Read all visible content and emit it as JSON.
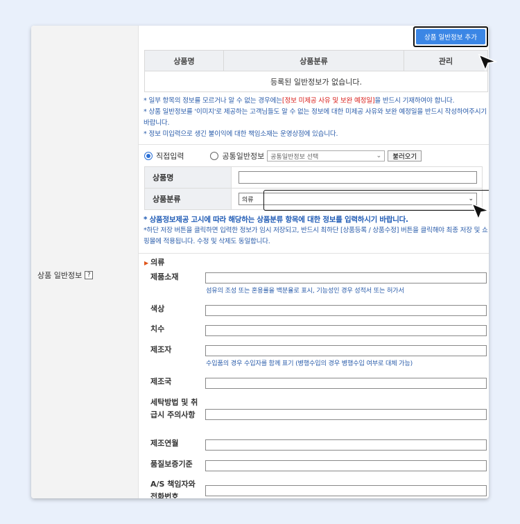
{
  "sidebar": {
    "label": "상품 일반정보",
    "help": "?"
  },
  "toolbar": {
    "add_button": "상품 일반정보 추가"
  },
  "list_table": {
    "headers": [
      "상품명",
      "상품분류",
      "관리"
    ],
    "empty_message": "등록된 일반정보가 없습니다."
  },
  "notes": {
    "line1_a": "* 일부 항목의 정보를 모르거나 알 수 없는 경우에는",
    "line1_red": "[정보 미제공 사유 및 보완 예정일]",
    "line1_b": "을 반드시 기재하여야 합니다.",
    "line2": "* 상품 일반정보를 '이미지'로 제공하는 고객님들도 알 수 없는 정보에 대한 미제공 사유와 보완 예정일을 반드시 작성하여주시기 바랍니다.",
    "line3": "* 정보 미입력으로 생긴 불이익에 대한 책임소재는 운영상점에 있습니다."
  },
  "input_mode": {
    "direct_label": "직접입력",
    "common_label": "공통일반정보",
    "common_select": "공통일반정보 선택",
    "load_button": "불러오기"
  },
  "form": {
    "name_label": "상품명",
    "category_label": "상품분류",
    "category_value": "의류"
  },
  "guide": {
    "bold": "* 상품정보제공 고시에 따라 해당하는 상품분류 항목에 대한 정보를 입력하시기 바랍니다.",
    "text": "*하단 저장 버튼을 클릭하면 입력한 정보가 임시 저장되고, 반드시 최하단 [상품등록 / 상품수정] 버튼을 클릭해야 최종 저장 및 쇼핑몰에 적용됩니다. 수정 및 삭제도 동일합니다."
  },
  "category_section": {
    "title": "의류",
    "fields": [
      {
        "label": "제품소재",
        "note": "섬유의 조성 또는 혼용률을 백분율로 표시, 기능성인 경우 성적서 또는 허가서"
      },
      {
        "label": "색상",
        "note": ""
      },
      {
        "label": "치수",
        "note": ""
      },
      {
        "label": "제조자",
        "note": "수입품의 경우 수입자를 함께 표기 (병행수입의 경우 병행수입 여부로 대체 가능)"
      },
      {
        "label": "제조국",
        "note": ""
      },
      {
        "label": "세탁방법 및 취급시 주의사항",
        "note": ""
      },
      {
        "label": "제조연월",
        "note": ""
      },
      {
        "label": "품질보증기준",
        "note": ""
      },
      {
        "label": "A/S 책임자와 전화번호",
        "note": ""
      }
    ]
  },
  "colors": {
    "accent": "#3b86e5",
    "note_blue": "#2a5caa",
    "warning_red": "#d9201c"
  }
}
